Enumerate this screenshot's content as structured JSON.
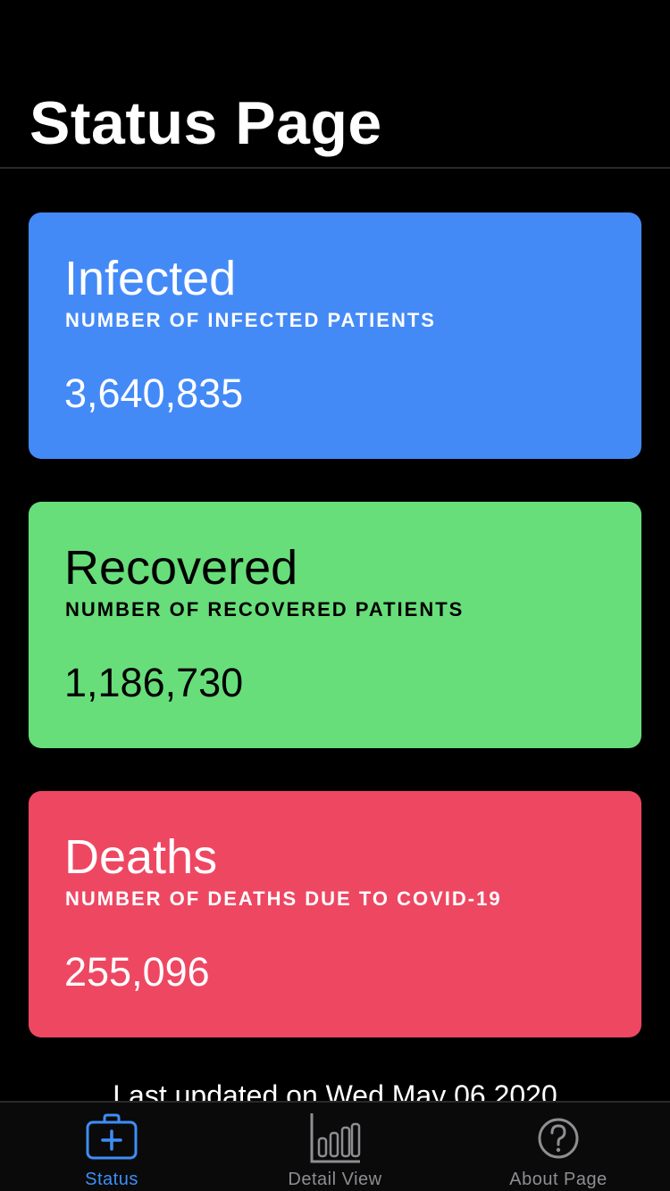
{
  "header": {
    "title": "Status Page"
  },
  "cards": [
    {
      "title": "Infected",
      "subtitle": "NUMBER OF INFECTED PATIENTS",
      "value": "3,640,835",
      "background": "#448AF7",
      "text_color": "#FFFFFF"
    },
    {
      "title": "Recovered",
      "subtitle": "NUMBER OF RECOVERED PATIENTS",
      "value": "1,186,730",
      "background": "#68DE7A",
      "text_color": "#000000"
    },
    {
      "title": "Deaths",
      "subtitle": "NUMBER OF DEATHS DUE TO COVID-19",
      "value": "255,096",
      "background": "#EE4762",
      "text_color": "#FFFFFF"
    }
  ],
  "footer": {
    "updated": "Last updated on Wed May 06 2020"
  },
  "tab_bar": {
    "active_color": "#3E8EF7",
    "inactive_color": "#8E8E93",
    "tabs": [
      {
        "label": "Status",
        "icon": "medical-kit-icon",
        "active": true
      },
      {
        "label": "Detail View",
        "icon": "bar-chart-icon",
        "active": false
      },
      {
        "label": "About Page",
        "icon": "question-mark-circle-icon",
        "active": false
      }
    ]
  }
}
